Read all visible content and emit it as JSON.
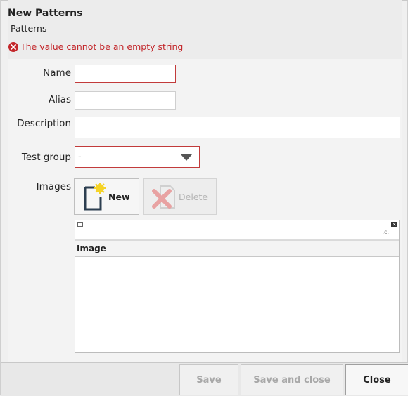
{
  "dialog": {
    "title": "New Patterns",
    "subtitle": "Patterns",
    "error_message": "The value cannot be an empty string"
  },
  "form": {
    "name_label": "Name",
    "name_value": "",
    "alias_label": "Alias",
    "alias_value": "",
    "description_label": "Description",
    "description_value": "",
    "test_group_label": "Test group",
    "test_group_value": "-",
    "images_label": "Images"
  },
  "images_toolbar": {
    "new_label": "New",
    "delete_label": "Delete"
  },
  "images_grid": {
    "columns": [
      "Image"
    ],
    "rows": []
  },
  "footer": {
    "save_label": "Save",
    "save_close_label": "Save and close",
    "close_label": "Close"
  },
  "colors": {
    "error": "#c3272b",
    "invalid_border": "#c23b3b"
  },
  "icons": {
    "error": "error-circle-icon",
    "new": "new-document-icon",
    "delete": "delete-document-icon",
    "dropdown": "dropdown-arrow-icon"
  }
}
